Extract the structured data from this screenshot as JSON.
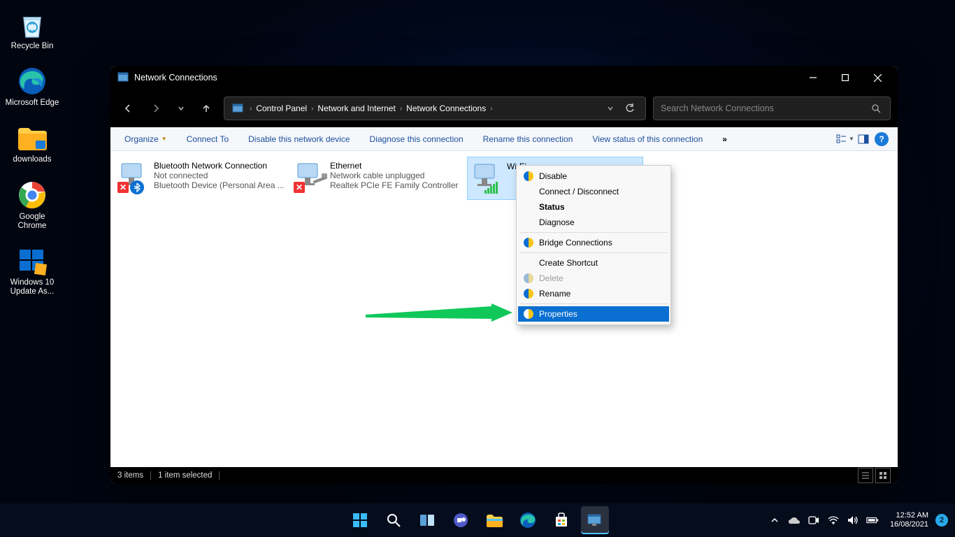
{
  "desktop": {
    "items": [
      {
        "label": "Recycle Bin"
      },
      {
        "label": "Microsoft Edge"
      },
      {
        "label": "downloads"
      },
      {
        "label": "Google Chrome"
      },
      {
        "label": "Windows 10 Update As..."
      }
    ]
  },
  "window": {
    "title": "Network Connections",
    "breadcrumb": [
      "Control Panel",
      "Network and Internet",
      "Network Connections"
    ],
    "search_placeholder": "Search Network Connections"
  },
  "toolbar": {
    "organize": "Organize",
    "items": [
      "Connect To",
      "Disable this network device",
      "Diagnose this connection",
      "Rename this connection",
      "View status of this connection"
    ],
    "overflow": "»"
  },
  "connections": [
    {
      "name": "Bluetooth Network Connection",
      "status": "Not connected",
      "device": "Bluetooth Device (Personal Area ..."
    },
    {
      "name": "Ethernet",
      "status": "Network cable unplugged",
      "device": "Realtek PCIe FE Family Controller"
    },
    {
      "name": "Wi-Fi",
      "status": "",
      "device": ""
    }
  ],
  "context_menu": {
    "items": [
      {
        "label": "Disable",
        "shield": true
      },
      {
        "label": "Connect / Disconnect"
      },
      {
        "label": "Status",
        "bold": true
      },
      {
        "label": "Diagnose"
      },
      {
        "sep": true
      },
      {
        "label": "Bridge Connections",
        "shield": true
      },
      {
        "sep": true
      },
      {
        "label": "Create Shortcut"
      },
      {
        "label": "Delete",
        "shield": true,
        "disabled": true
      },
      {
        "label": "Rename",
        "shield": true
      },
      {
        "sep": true
      },
      {
        "label": "Properties",
        "shield": true,
        "highlight": true
      }
    ]
  },
  "statusbar": {
    "count": "3 items",
    "selected": "1 item selected"
  },
  "tray": {
    "time": "12:52 AM",
    "date": "16/08/2021",
    "notif_count": "2"
  }
}
